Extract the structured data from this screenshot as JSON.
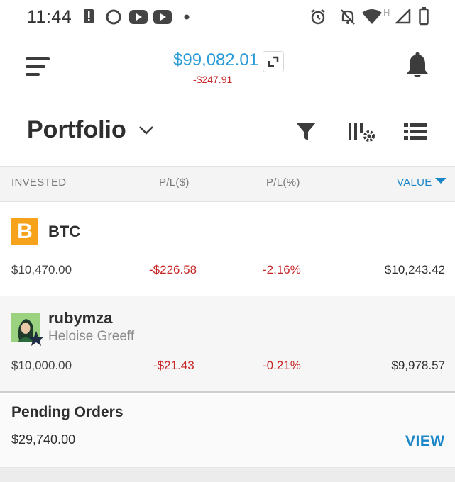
{
  "status_bar": {
    "time": "11:44",
    "icons": [
      "alert-icon",
      "circle-app-icon",
      "youtube-icon",
      "youtube-icon",
      "dot-icon",
      "alarm-icon",
      "notifications-off-icon",
      "wifi-icon",
      "network-type-icon",
      "signal-icon",
      "battery-icon"
    ],
    "network_label": "H"
  },
  "header": {
    "equity": "$99,082.01",
    "equity_change": "-$247.91",
    "equity_color": "#2a9bd6",
    "negative_color": "#c62828"
  },
  "title_row": {
    "title": "Portfolio"
  },
  "table": {
    "columns": [
      "INVESTED",
      "P/L($)",
      "P/L(%)",
      "VALUE"
    ],
    "sorted_by": "VALUE",
    "rows": [
      {
        "name": "BTC",
        "subtitle": "",
        "icon": "bitcoin-icon",
        "icon_glyph": "B",
        "invested": "$10,470.00",
        "pl_usd": "-$226.58",
        "pl_pct": "-2.16%",
        "value": "$10,243.42"
      },
      {
        "name": "rubymza",
        "subtitle": "Heloise Greeff",
        "icon": "trader-avatar",
        "invested": "$10,000.00",
        "pl_usd": "-$21.43",
        "pl_pct": "-0.21%",
        "value": "$9,978.57"
      }
    ]
  },
  "pending_orders": {
    "title": "Pending Orders",
    "amount": "$29,740.00",
    "action_label": "VIEW"
  },
  "colors": {
    "accent": "#1a86c7",
    "bitcoin": "#f7a21b",
    "negative": "#c62828"
  }
}
